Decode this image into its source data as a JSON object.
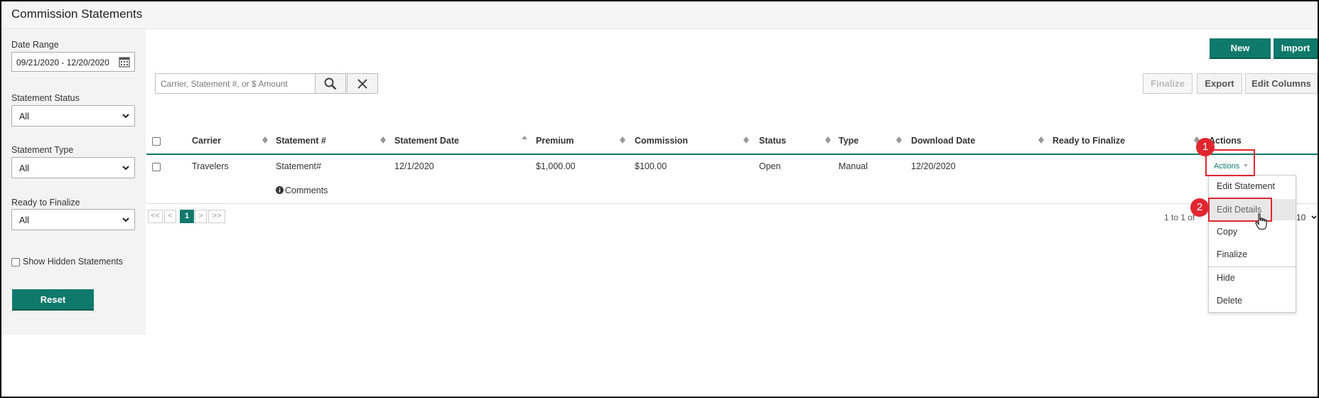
{
  "app": {
    "title": "Commission Statements"
  },
  "sidebar": {
    "date_range_label": "Date Range",
    "date_range_value": "09/21/2020 - 12/20/2020",
    "statement_status_label": "Statement Status",
    "statement_status_value": "All",
    "statement_type_label": "Statement Type",
    "statement_type_value": "All",
    "ready_to_finalize_label": "Ready to Finalize",
    "ready_to_finalize_value": "All",
    "show_hidden_label": "Show Hidden Statements",
    "reset_label": "Reset"
  },
  "toolbar": {
    "new_label": "New",
    "import_label": "Import",
    "finalize_label": "Finalize",
    "export_label": "Export",
    "edit_columns_label": "Edit Columns"
  },
  "search": {
    "placeholder": "Carrier, Statement #, or $ Amount"
  },
  "table": {
    "headers": [
      "Carrier",
      "Statement #",
      "Statement Date",
      "Premium",
      "Commission",
      "Status",
      "Type",
      "Download Date",
      "Ready to Finalize",
      "Actions"
    ],
    "rows": [
      {
        "carrier": "Travelers",
        "statement_no": "Statement#",
        "statement_date": "12/1/2020",
        "premium": "$1,000.00",
        "commission": "$100.00",
        "status": "Open",
        "type": "Manual",
        "download_date": "12/20/2020",
        "actions_label": "Actions",
        "comments_label": "Comments"
      }
    ]
  },
  "pagination": {
    "first": "<<",
    "prev": "<",
    "current": "1",
    "next": ">",
    "last": ">>",
    "range_text": "1 to 1 of",
    "page_size": "10"
  },
  "actions_menu": {
    "items": [
      "Edit Statement",
      "Edit Details",
      "Copy",
      "Finalize",
      "Hide",
      "Delete"
    ],
    "highlighted": "Edit Details"
  },
  "callouts": [
    "1",
    "2"
  ],
  "colors": {
    "accent": "#0f7a6c",
    "callout": "#e0262f"
  },
  "icons": [
    "calendar-icon",
    "chevron-down-icon",
    "search-icon",
    "close-icon",
    "sort-icon",
    "info-icon",
    "caret-down-icon",
    "hand-cursor-icon"
  ]
}
